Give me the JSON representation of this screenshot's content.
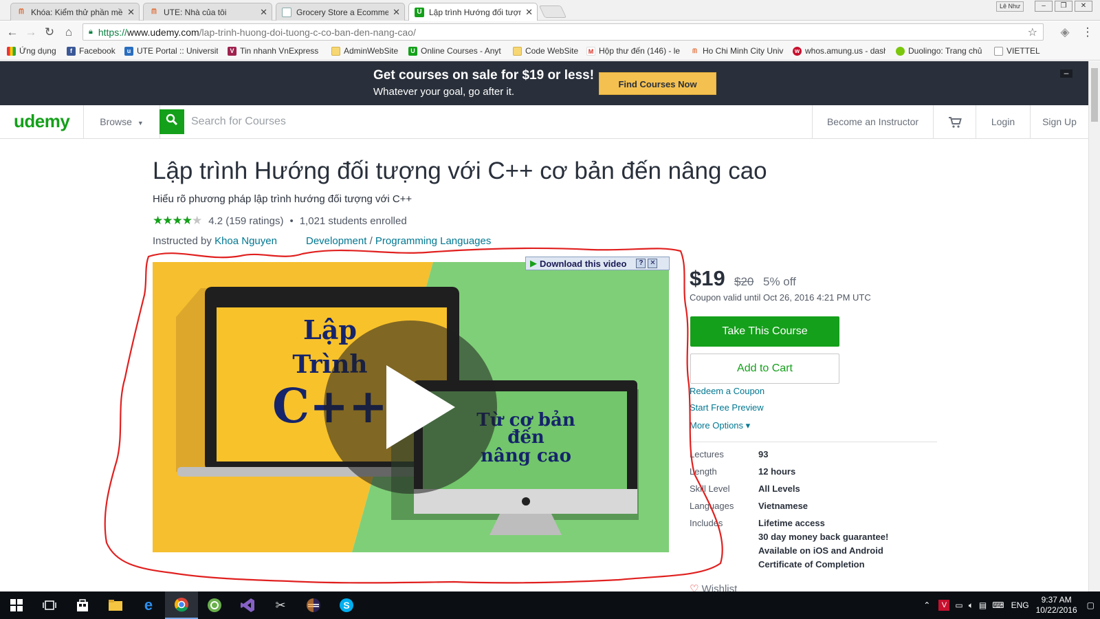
{
  "browser": {
    "tabs": [
      {
        "title": "Khóa: Kiểm thử phần mề",
        "favicon": "ute-icon",
        "active": false
      },
      {
        "title": "UTE: Nhà của tôi",
        "favicon": "ute-icon",
        "active": false
      },
      {
        "title": "Grocery Store a Ecomme",
        "favicon": "document-icon",
        "active": false
      },
      {
        "title": "Lập trình Hướng đối tượn",
        "favicon": "udemy-icon",
        "active": true
      }
    ],
    "user_badge": "Lê Như",
    "url": {
      "scheme": "https://",
      "host": "www.udemy.com",
      "path": "/lap-trinh-huong-doi-tuong-c-co-ban-den-nang-cao/"
    },
    "bookmarks": [
      {
        "label": "Ứng dụng",
        "icon": "apps-grid-icon"
      },
      {
        "label": "Facebook",
        "icon": "facebook-icon"
      },
      {
        "label": "UTE Portal :: University",
        "icon": "ute-icon"
      },
      {
        "label": "Tin nhanh VnExpress -",
        "icon": "vnexpress-icon"
      },
      {
        "label": "AdminWebSite",
        "icon": "folder-icon"
      },
      {
        "label": "Online Courses - Anyt",
        "icon": "udemy-icon"
      },
      {
        "label": "Code WebSite",
        "icon": "folder-icon"
      },
      {
        "label": "Hộp thư đến (146) - le",
        "icon": "gmail-icon"
      },
      {
        "label": "Ho Chi Minh City Univ",
        "icon": "ute-icon"
      },
      {
        "label": "whos.amung.us - dash",
        "icon": "whos-amungus-icon"
      },
      {
        "label": "Duolingo: Trang chủ",
        "icon": "duolingo-icon"
      },
      {
        "label": "VIETTEL",
        "icon": "document-icon"
      }
    ]
  },
  "promo": {
    "headline": "Get courses on sale for $19 or less!",
    "subline": "Whatever your goal, go after it.",
    "button": "Find Courses Now",
    "close": "–"
  },
  "header": {
    "logo": "udemy",
    "browse": "Browse",
    "search_placeholder": "Search for Courses",
    "become_instructor": "Become an Instructor",
    "login": "Login",
    "signup": "Sign Up"
  },
  "course": {
    "title": "Lập trình Hướng đối tượng với C++ cơ bản đến nâng cao",
    "subtitle": "Hiểu rõ phương pháp lập trình hướng đối tượng với C++",
    "rating_value": 4.2,
    "rating_text": "4.2 (159 ratings)",
    "students": "1,021 students enrolled",
    "instructed_prefix": "Instructed by",
    "instructor": "Khoa Nguyen",
    "category": "Development",
    "category_sep": "/",
    "subcategory": "Programming Languages"
  },
  "video": {
    "download_label": "Download this video",
    "thumb_text_left": [
      "Lập",
      "Trình",
      "C++"
    ],
    "thumb_text_right": [
      "Từ cơ bản",
      "đến",
      "nâng cao"
    ],
    "colors": {
      "left_bg": "#f6bf2f",
      "right_bg": "#7fcf78",
      "screen_left": "#f8c22b",
      "screen_right": "#73c66b",
      "text": "#15246b"
    }
  },
  "purchase": {
    "price": "$19",
    "original_price": "$20",
    "discount": "5% off",
    "coupon_valid": "Coupon valid until Oct 26, 2016 4:21 PM UTC",
    "take_course": "Take This Course",
    "add_to_cart": "Add to Cart",
    "redeem": "Redeem a Coupon",
    "preview": "Start Free Preview",
    "more_options": "More Options ▾",
    "details": [
      {
        "label": "Lectures",
        "value": "93"
      },
      {
        "label": "Length",
        "value": "12 hours"
      },
      {
        "label": "Skill Level",
        "value": "All Levels"
      },
      {
        "label": "Languages",
        "value": "Vietnamese"
      },
      {
        "label": "Includes",
        "value": "Lifetime access"
      }
    ],
    "includes_extra": [
      "30 day money back guarantee!",
      "Available on iOS and Android",
      "Certificate of Completion"
    ],
    "wishlist": "Wishlist"
  },
  "taskbar": {
    "apps": [
      "windows-start-icon",
      "task-view-icon",
      "store-icon",
      "file-explorer-icon",
      "edge-icon",
      "chrome-icon",
      "greenshot-icon",
      "visual-studio-icon",
      "tools-icon",
      "eclipse-icon",
      "skype-icon"
    ],
    "language": "ENG",
    "time": "9:37 AM",
    "date": "10/22/2016"
  },
  "colors": {
    "udemy_green": "#14a01a",
    "promo_bg": "#29303b",
    "promo_button": "#f4c150",
    "link": "#007791",
    "annotation_red": "#e0201f"
  }
}
